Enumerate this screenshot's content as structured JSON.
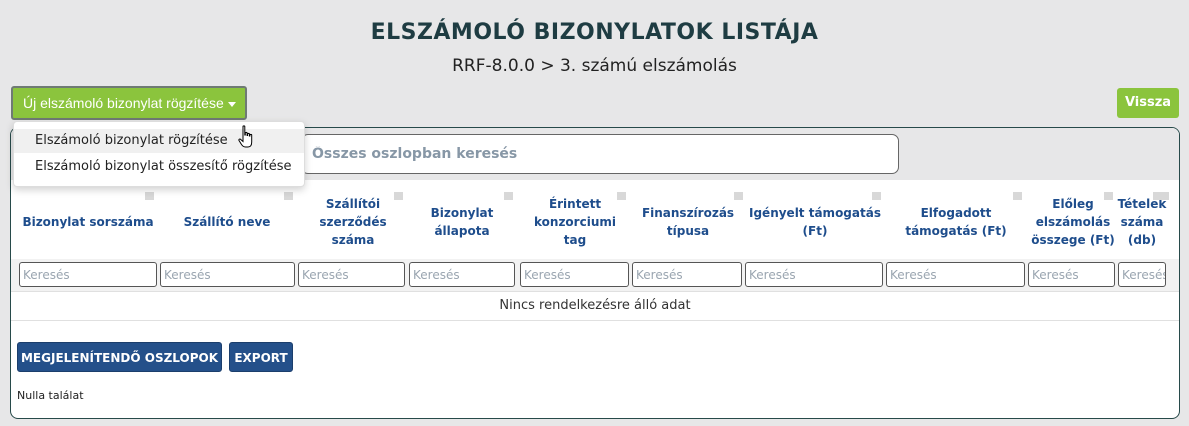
{
  "header": {
    "title": "ELSZÁMOLÓ BIZONYLATOK LISTÁJA",
    "subtitle": "RRF-8.0.0 > 3. számú elszámolás"
  },
  "toolbar": {
    "new_button_label": "Új elszámoló bizonylat rögzítése",
    "back_label": "Vissza"
  },
  "dropdown": {
    "items": [
      {
        "label": "Elszámoló bizonylat rögzítése"
      },
      {
        "label": "Elszámoló bizonylat összesítő rögzítése"
      }
    ]
  },
  "search": {
    "placeholder": "Összes oszlopban keresés"
  },
  "table": {
    "columns": [
      {
        "label": "Bizonylat sorszáma"
      },
      {
        "label": "Szállító neve"
      },
      {
        "label": "Szállítói szerződés száma"
      },
      {
        "label": "Bizonylat állapota"
      },
      {
        "label": "Érintett konzorciumi tag"
      },
      {
        "label": "Finanszírozás típusa"
      },
      {
        "label": "Igényelt támogatás (Ft)"
      },
      {
        "label": "Elfogadott támogatás (Ft)"
      },
      {
        "label": "Előleg elszámolás összege (Ft)"
      },
      {
        "label": "Tételek száma (db)"
      }
    ],
    "filter_placeholder": "Keresés",
    "empty_text": "Nincs rendelkezésre álló adat"
  },
  "footer": {
    "columns_button": "MEGJELENÍTENDŐ OSZLOPOK",
    "export_button": "EXPORT",
    "result_count": "Nulla találat"
  },
  "colors": {
    "accent_green": "#8bc43d",
    "header_blue": "#1e4d8c",
    "button_blue": "#24508a",
    "title_dark": "#1e3c42"
  }
}
